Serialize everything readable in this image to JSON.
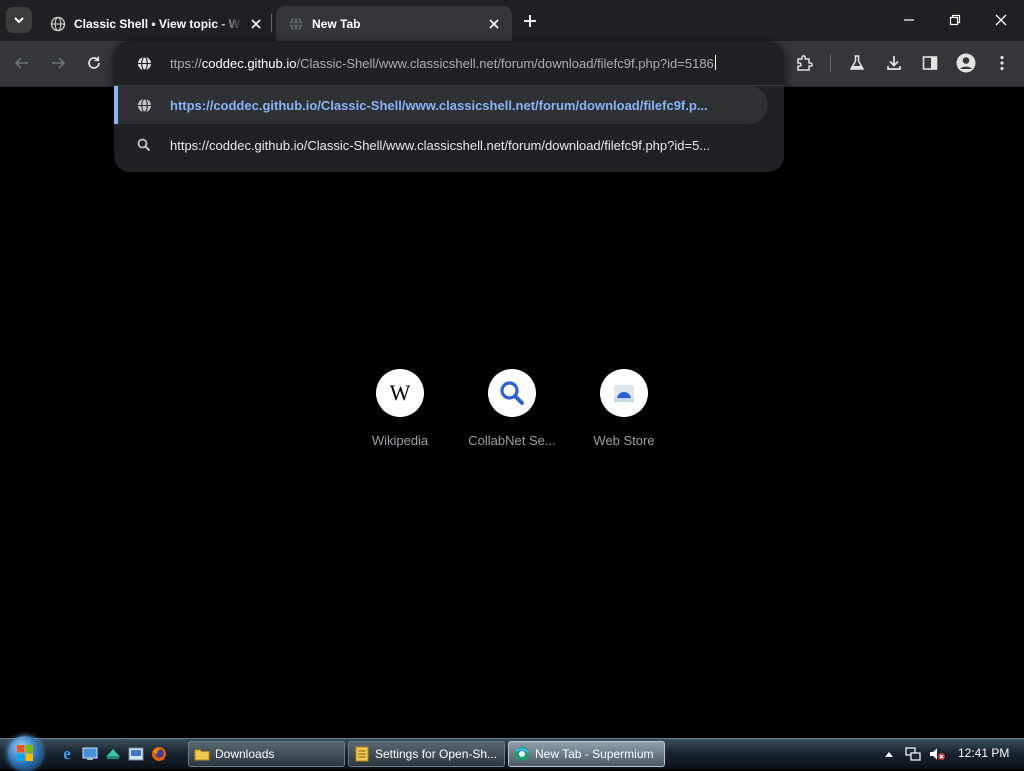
{
  "tabs": [
    {
      "title": "Classic Shell • View topic - Windows",
      "active": false
    },
    {
      "title": "New Tab",
      "active": true
    }
  ],
  "omnibox": {
    "prefix": "ttps://",
    "host": "coddec.github.io",
    "path": "/Classic-Shell/www.classicshell.net/forum/download/filefc9f.php?id=5186",
    "suggestions": [
      {
        "text": "https://coddec.github.io/Classic-Shell/www.classicshell.net/forum/download/filefc9f.p...",
        "icon": "globe-icon",
        "selected": true
      },
      {
        "text": "https://coddec.github.io/Classic-Shell/www.classicshell.net/forum/download/filefc9f.php?id=5...",
        "icon": "search-icon",
        "selected": false
      }
    ]
  },
  "shortcuts": [
    {
      "label": "Wikipedia",
      "icon": "wikipedia-icon"
    },
    {
      "label": "CollabNet Se...",
      "icon": "search-icon"
    },
    {
      "label": "Web Store",
      "icon": "web-store-icon"
    }
  ],
  "taskbar": {
    "buttons": [
      {
        "label": "Downloads",
        "icon": "folder-icon"
      },
      {
        "label": "Settings for Open-Sh...",
        "icon": "settings-icon"
      },
      {
        "label": "New Tab - Supermium",
        "icon": "supermium-icon"
      }
    ],
    "clock": "12:41 PM"
  },
  "colors": {
    "accent": "#8ab4f8",
    "tab_strip": "#202124",
    "toolbar": "#35363a",
    "page_bg": "#000000"
  }
}
